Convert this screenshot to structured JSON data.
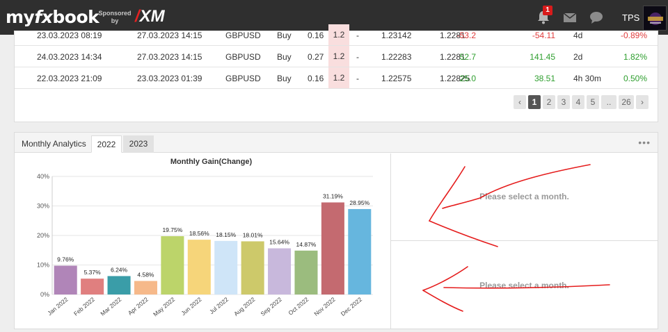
{
  "header": {
    "logo_text_1": "my",
    "logo_text_fx": "fx",
    "logo_text_2": "book",
    "sponsor_line1": "Sponsored",
    "sponsor_line2": "by",
    "sponsor_name": "XM",
    "notification_count": "1",
    "user_label": "TPS"
  },
  "trades": {
    "rows": [
      {
        "open": "23.03.2023 08:19",
        "close": "27.03.2023 14:15",
        "symbol": "GBPUSD",
        "action": "Buy",
        "lots": "0.16",
        "sl": "1.2",
        "tp": "-",
        "open_price": "1.23142",
        "close_price": "1.2281",
        "pips": "-53.2",
        "profit": "-54.11",
        "duration": "4d",
        "gain": "-0.89%",
        "tone": "neg"
      },
      {
        "open": "24.03.2023 14:34",
        "close": "27.03.2023 14:15",
        "symbol": "GBPUSD",
        "action": "Buy",
        "lots": "0.27",
        "sl": "1.2",
        "tp": "-",
        "open_price": "1.22283",
        "close_price": "1.2281",
        "pips": "52.7",
        "profit": "141.45",
        "duration": "2d",
        "gain": "1.82%",
        "tone": "pos"
      },
      {
        "open": "22.03.2023 21:09",
        "close": "23.03.2023 01:39",
        "symbol": "GBPUSD",
        "action": "Buy",
        "lots": "0.16",
        "sl": "1.2",
        "tp": "-",
        "open_price": "1.22575",
        "close_price": "1.22825",
        "pips": "25.0",
        "profit": "38.51",
        "duration": "4h 30m",
        "gain": "0.50%",
        "tone": "pos"
      }
    ]
  },
  "pagination": {
    "prev": "‹",
    "pages": [
      "1",
      "2",
      "3",
      "4",
      "5",
      "..",
      "26"
    ],
    "active": "1",
    "next": "›"
  },
  "analytics": {
    "title": "Monthly Analytics",
    "tabs": [
      "2022",
      "2023"
    ],
    "active_tab": "2022",
    "message_top": "Please select a month.",
    "message_bottom": "Please select a month.",
    "menu_dots": "•••"
  },
  "chart_data": {
    "type": "bar",
    "title": "Monthly Gain(Change)",
    "categories": [
      "Jan 2022",
      "Feb 2022",
      "Mar 2022",
      "Apr 2022",
      "May 2022",
      "Jun 2022",
      "Jul 2022",
      "Aug 2022",
      "Sep 2022",
      "Oct 2022",
      "Nov 2022",
      "Dec 2022"
    ],
    "values": [
      9.76,
      5.37,
      6.24,
      4.58,
      19.75,
      18.56,
      18.15,
      18.01,
      15.64,
      14.87,
      31.19,
      28.95
    ],
    "data_labels": [
      "9.76%",
      "5.37%",
      "6.24%",
      "4.58%",
      "19.75%",
      "18.56%",
      "18.15%",
      "18.01%",
      "15.64%",
      "14.87%",
      "31.19%",
      "28.95%"
    ],
    "colors": [
      "#b085b8",
      "#e07f7f",
      "#3a9da8",
      "#f6b98a",
      "#bcd46a",
      "#f6d57a",
      "#cfe5f8",
      "#cdc96a",
      "#c8b8dc",
      "#9bbc7e",
      "#c46a70",
      "#66b6de"
    ],
    "ylim": [
      0,
      40
    ],
    "yticks": [
      0,
      10,
      20,
      30,
      40
    ],
    "ytick_labels": [
      "0%",
      "10%",
      "20%",
      "30%",
      "40%"
    ],
    "grid": true,
    "xlabel": "",
    "ylabel": ""
  }
}
